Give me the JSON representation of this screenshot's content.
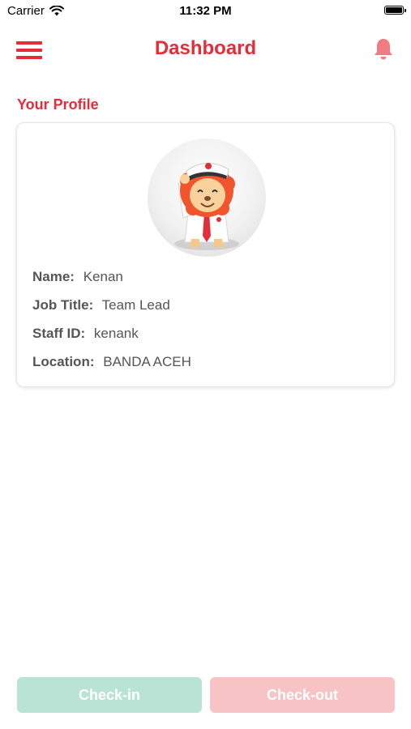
{
  "status_bar": {
    "carrier": "Carrier",
    "time": "11:32 PM"
  },
  "header": {
    "title": "Dashboard"
  },
  "profile": {
    "section_title": "Your Profile",
    "fields": [
      {
        "label": "Name:",
        "value": "Kenan"
      },
      {
        "label": "Job Title:",
        "value": "Team Lead"
      },
      {
        "label": "Staff ID:",
        "value": "kenank"
      },
      {
        "label": "Location:",
        "value": "BANDA ACEH"
      }
    ]
  },
  "actions": {
    "checkin_label": "Check-in",
    "checkout_label": "Check-out"
  },
  "colors": {
    "accent": "#e52d3a",
    "checkin_bg": "#b9e4d5",
    "checkout_bg": "#f8c3c5"
  },
  "icons": [
    "wifi-icon",
    "battery-icon",
    "menu-icon",
    "bell-icon",
    "avatar-lion-icon"
  ]
}
